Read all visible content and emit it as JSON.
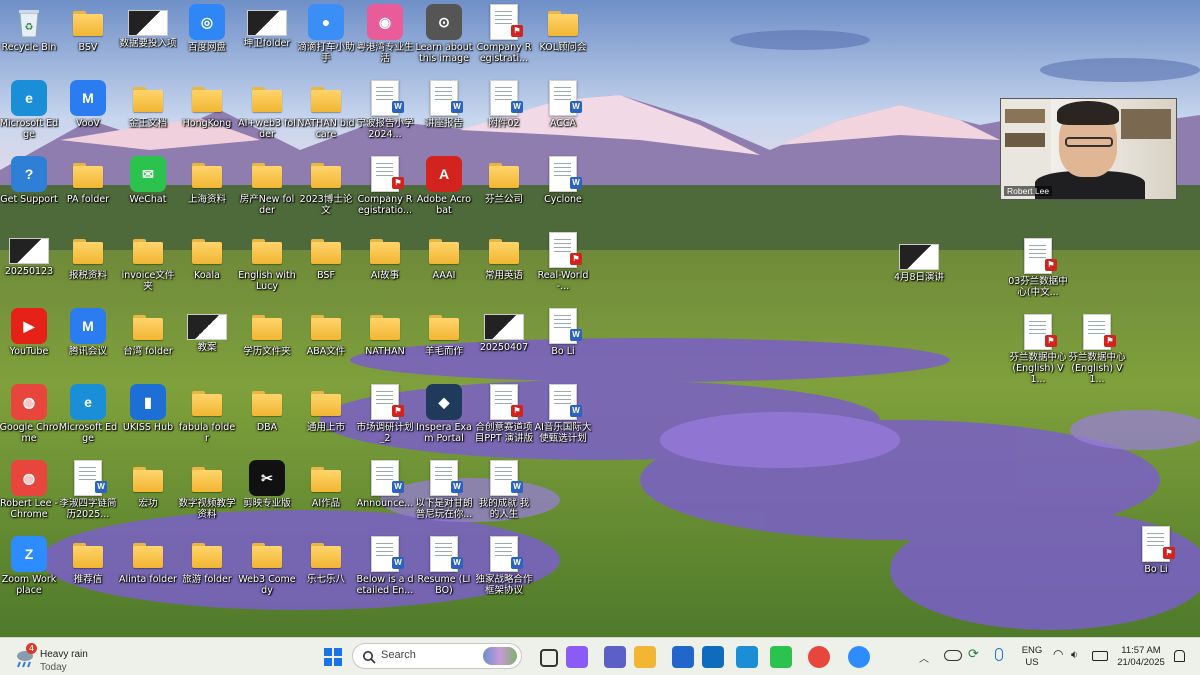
{
  "desktop": {
    "icons": [
      {
        "label": "Recycle Bin",
        "type": "recycle",
        "col": 0,
        "row": 0
      },
      {
        "label": "BSV",
        "type": "folder",
        "col": 1,
        "row": 0
      },
      {
        "label": "数据要投入项",
        "type": "thumb",
        "col": 2,
        "row": 0
      },
      {
        "label": "百度网盘",
        "type": "app",
        "color": "#2f86f6",
        "glyph": "◎",
        "col": 3,
        "row": 0
      },
      {
        "label": "坤卫folder",
        "type": "thumb",
        "col": 4,
        "row": 0
      },
      {
        "label": "滴滴打车小助手",
        "type": "app",
        "color": "#3a8ef5",
        "glyph": "●",
        "col": 5,
        "row": 0
      },
      {
        "label": "粤港湾专业生活",
        "type": "app",
        "color": "#e85c9a",
        "glyph": "◉",
        "col": 6,
        "row": 0
      },
      {
        "label": "Learn about this image",
        "type": "app",
        "color": "#555",
        "glyph": "⊙",
        "col": 7,
        "row": 0
      },
      {
        "label": "Company Registrati...",
        "type": "doc",
        "badge": "p",
        "col": 8,
        "row": 0
      },
      {
        "label": "KOL顾问会",
        "type": "folder",
        "col": 9,
        "row": 0
      },
      {
        "label": "Microsoft Edge",
        "type": "app",
        "color": "#1a8fd8",
        "glyph": "e",
        "col": 0,
        "row": 1
      },
      {
        "label": "VooV",
        "type": "app",
        "color": "#2a7cf0",
        "glyph": "M",
        "col": 1,
        "row": 1
      },
      {
        "label": "金王文档",
        "type": "folder",
        "col": 2,
        "row": 1
      },
      {
        "label": "HongKong",
        "type": "folder",
        "col": 3,
        "row": 1
      },
      {
        "label": "AI+web3 folder",
        "type": "folder",
        "col": 4,
        "row": 1
      },
      {
        "label": "NATHAN bid care",
        "type": "folder",
        "col": 5,
        "row": 1
      },
      {
        "label": "宁波报告小学2024...",
        "type": "doc",
        "badge": "w",
        "col": 6,
        "row": 1
      },
      {
        "label": "讲座报告",
        "type": "doc",
        "badge": "w",
        "col": 7,
        "row": 1
      },
      {
        "label": "附件02",
        "type": "doc",
        "badge": "w",
        "col": 8,
        "row": 1
      },
      {
        "label": "ACCA",
        "type": "doc",
        "badge": "w",
        "col": 9,
        "row": 1
      },
      {
        "label": "Get Support",
        "type": "app",
        "color": "#2f7fd6",
        "glyph": "?",
        "col": 0,
        "row": 2
      },
      {
        "label": "PA folder",
        "type": "folder",
        "col": 1,
        "row": 2
      },
      {
        "label": "WeChat",
        "type": "app",
        "color": "#2bc24d",
        "glyph": "✉",
        "col": 2,
        "row": 2
      },
      {
        "label": "上海资料",
        "type": "folder",
        "col": 3,
        "row": 2
      },
      {
        "label": "房产New folder",
        "type": "folder",
        "col": 4,
        "row": 2
      },
      {
        "label": "2023博士论文",
        "type": "folder",
        "col": 5,
        "row": 2
      },
      {
        "label": "Company Registratio...",
        "type": "doc",
        "badge": "p",
        "col": 6,
        "row": 2
      },
      {
        "label": "Adobe Acrobat",
        "type": "app",
        "color": "#d2231e",
        "glyph": "A",
        "col": 7,
        "row": 2
      },
      {
        "label": "芬兰公司",
        "type": "folder",
        "col": 8,
        "row": 2
      },
      {
        "label": "Cyclone",
        "type": "doc",
        "badge": "w",
        "col": 9,
        "row": 2
      },
      {
        "label": "20250123",
        "type": "thumb",
        "col": 0,
        "row": 3
      },
      {
        "label": "报税资料",
        "type": "folder",
        "col": 1,
        "row": 3
      },
      {
        "label": "invoice文件夹",
        "type": "folder",
        "col": 2,
        "row": 3
      },
      {
        "label": "Koala",
        "type": "folder",
        "col": 3,
        "row": 3
      },
      {
        "label": "English with Lucy",
        "type": "folder",
        "col": 4,
        "row": 3
      },
      {
        "label": "BSF",
        "type": "folder",
        "col": 5,
        "row": 3
      },
      {
        "label": "AI故事",
        "type": "folder",
        "col": 6,
        "row": 3
      },
      {
        "label": "AAAI",
        "type": "folder",
        "col": 7,
        "row": 3
      },
      {
        "label": "常用英语",
        "type": "folder",
        "col": 8,
        "row": 3
      },
      {
        "label": "Real-World-...",
        "type": "doc",
        "badge": "p",
        "col": 9,
        "row": 3
      },
      {
        "label": "YouTube",
        "type": "app",
        "color": "#e62117",
        "glyph": "▶",
        "col": 0,
        "row": 4
      },
      {
        "label": "腾讯会议",
        "type": "app",
        "color": "#2a7cf0",
        "glyph": "M",
        "col": 1,
        "row": 4
      },
      {
        "label": "台湾 folder",
        "type": "folder",
        "col": 2,
        "row": 4
      },
      {
        "label": "教案",
        "type": "thumb",
        "col": 3,
        "row": 4
      },
      {
        "label": "学历文件夹",
        "type": "folder",
        "col": 4,
        "row": 4
      },
      {
        "label": "ABA文件",
        "type": "folder",
        "col": 5,
        "row": 4
      },
      {
        "label": "NATHAN",
        "type": "folder",
        "col": 6,
        "row": 4
      },
      {
        "label": "羊毛而作",
        "type": "folder",
        "col": 7,
        "row": 4
      },
      {
        "label": "20250407",
        "type": "thumb",
        "col": 8,
        "row": 4
      },
      {
        "label": "Bo Li",
        "type": "doc",
        "badge": "w",
        "col": 9,
        "row": 4
      },
      {
        "label": "Google Chrome",
        "type": "app",
        "color": "#e8453c",
        "glyph": "◍",
        "col": 0,
        "row": 5
      },
      {
        "label": "Microsoft Edge",
        "type": "app",
        "color": "#1a8fd8",
        "glyph": "e",
        "col": 1,
        "row": 5
      },
      {
        "label": "UKISS Hub",
        "type": "app",
        "color": "#1d6fd6",
        "glyph": "▮",
        "col": 2,
        "row": 5
      },
      {
        "label": "fabula folder",
        "type": "folder",
        "col": 3,
        "row": 5
      },
      {
        "label": "DBA",
        "type": "folder",
        "col": 4,
        "row": 5
      },
      {
        "label": "通用上市",
        "type": "folder",
        "col": 5,
        "row": 5
      },
      {
        "label": "市场调研计划_2",
        "type": "doc",
        "badge": "p",
        "col": 6,
        "row": 5
      },
      {
        "label": "Inspera Exam Portal",
        "type": "app",
        "color": "#1f3a5a",
        "glyph": "◆",
        "col": 7,
        "row": 5
      },
      {
        "label": "合创意赛道项目PPT 演讲版",
        "type": "doc",
        "badge": "p",
        "col": 8,
        "row": 5
      },
      {
        "label": "AI音乐国际大使甄选计划",
        "type": "doc",
        "badge": "w",
        "col": 9,
        "row": 5
      },
      {
        "label": "Robert Lee - Chrome",
        "type": "app",
        "color": "#e8453c",
        "glyph": "◍",
        "col": 0,
        "row": 6
      },
      {
        "label": "李淑四字链简历2025...",
        "type": "doc",
        "badge": "w",
        "col": 1,
        "row": 6
      },
      {
        "label": "宏功",
        "type": "folder",
        "col": 2,
        "row": 6
      },
      {
        "label": "数字视频教学资料",
        "type": "folder",
        "col": 3,
        "row": 6
      },
      {
        "label": "剪映专业版",
        "type": "app",
        "color": "#111",
        "glyph": "✂",
        "col": 4,
        "row": 6
      },
      {
        "label": "AI作品",
        "type": "folder",
        "col": 5,
        "row": 6
      },
      {
        "label": "Announce...",
        "type": "doc",
        "badge": "w",
        "col": 6,
        "row": 6
      },
      {
        "label": "以下是对甘朗普尼玩在你...",
        "type": "doc",
        "badge": "w",
        "col": 7,
        "row": 6
      },
      {
        "label": "我的成就 我的人生",
        "type": "doc",
        "badge": "w",
        "col": 8,
        "row": 6
      },
      {
        "label": "Zoom Workplace",
        "type": "app",
        "color": "#2d8cff",
        "glyph": "Z",
        "col": 0,
        "row": 7
      },
      {
        "label": "推荐信",
        "type": "folder",
        "col": 1,
        "row": 7
      },
      {
        "label": "Alinta folder",
        "type": "folder",
        "col": 2,
        "row": 7
      },
      {
        "label": "旅游 folder",
        "type": "folder",
        "col": 3,
        "row": 7
      },
      {
        "label": "Web3 Comedy",
        "type": "folder",
        "col": 4,
        "row": 7
      },
      {
        "label": "乐七乐八",
        "type": "folder",
        "col": 5,
        "row": 7
      },
      {
        "label": "Below is a detailed En...",
        "type": "doc",
        "badge": "w",
        "col": 6,
        "row": 7
      },
      {
        "label": "Resume (LI BO)",
        "type": "doc",
        "badge": "w",
        "col": 7,
        "row": 7
      },
      {
        "label": "独家战略合作框架协议",
        "type": "doc",
        "badge": "w",
        "col": 8,
        "row": 7
      }
    ],
    "extra_icons": [
      {
        "label": "4月8日演讲",
        "type": "thumb"
      },
      {
        "label": "03芬兰数据中心(中文...",
        "type": "doc",
        "badge": "p"
      },
      {
        "label": "芬兰数据中心(English) V1...",
        "type": "doc",
        "badge": "p"
      },
      {
        "label": "芬兰数据中心(English) V1...",
        "type": "doc",
        "badge": "p"
      },
      {
        "label": "Bo Li",
        "type": "doc",
        "badge": "p"
      }
    ]
  },
  "video_call": {
    "participant_name": "Robert Lee"
  },
  "taskbar": {
    "weather": {
      "condition": "Heavy rain",
      "day": "Today",
      "alert_count": "4"
    },
    "search_placeholder": "Search",
    "apps": [
      {
        "name": "start-button",
        "color": "#1a73e8"
      },
      {
        "name": "task-view",
        "color": "#333"
      },
      {
        "name": "copilot",
        "color": "#8a5cf5"
      },
      {
        "name": "teams",
        "color": "#5b5fc7"
      },
      {
        "name": "file-explorer",
        "color": "#f2b632"
      },
      {
        "name": "microsoft-store",
        "color": "#2266cc"
      },
      {
        "name": "outlook",
        "color": "#0f6cbd"
      },
      {
        "name": "edge",
        "color": "#1a8fd8"
      },
      {
        "name": "wechat",
        "color": "#2bc24d"
      },
      {
        "name": "chrome",
        "color": "#e8453c"
      },
      {
        "name": "zoom",
        "color": "#2d8cff"
      }
    ],
    "tray": {
      "language": "ENG",
      "region": "US",
      "time": "11:57 AM",
      "date": "21/04/2025"
    }
  }
}
